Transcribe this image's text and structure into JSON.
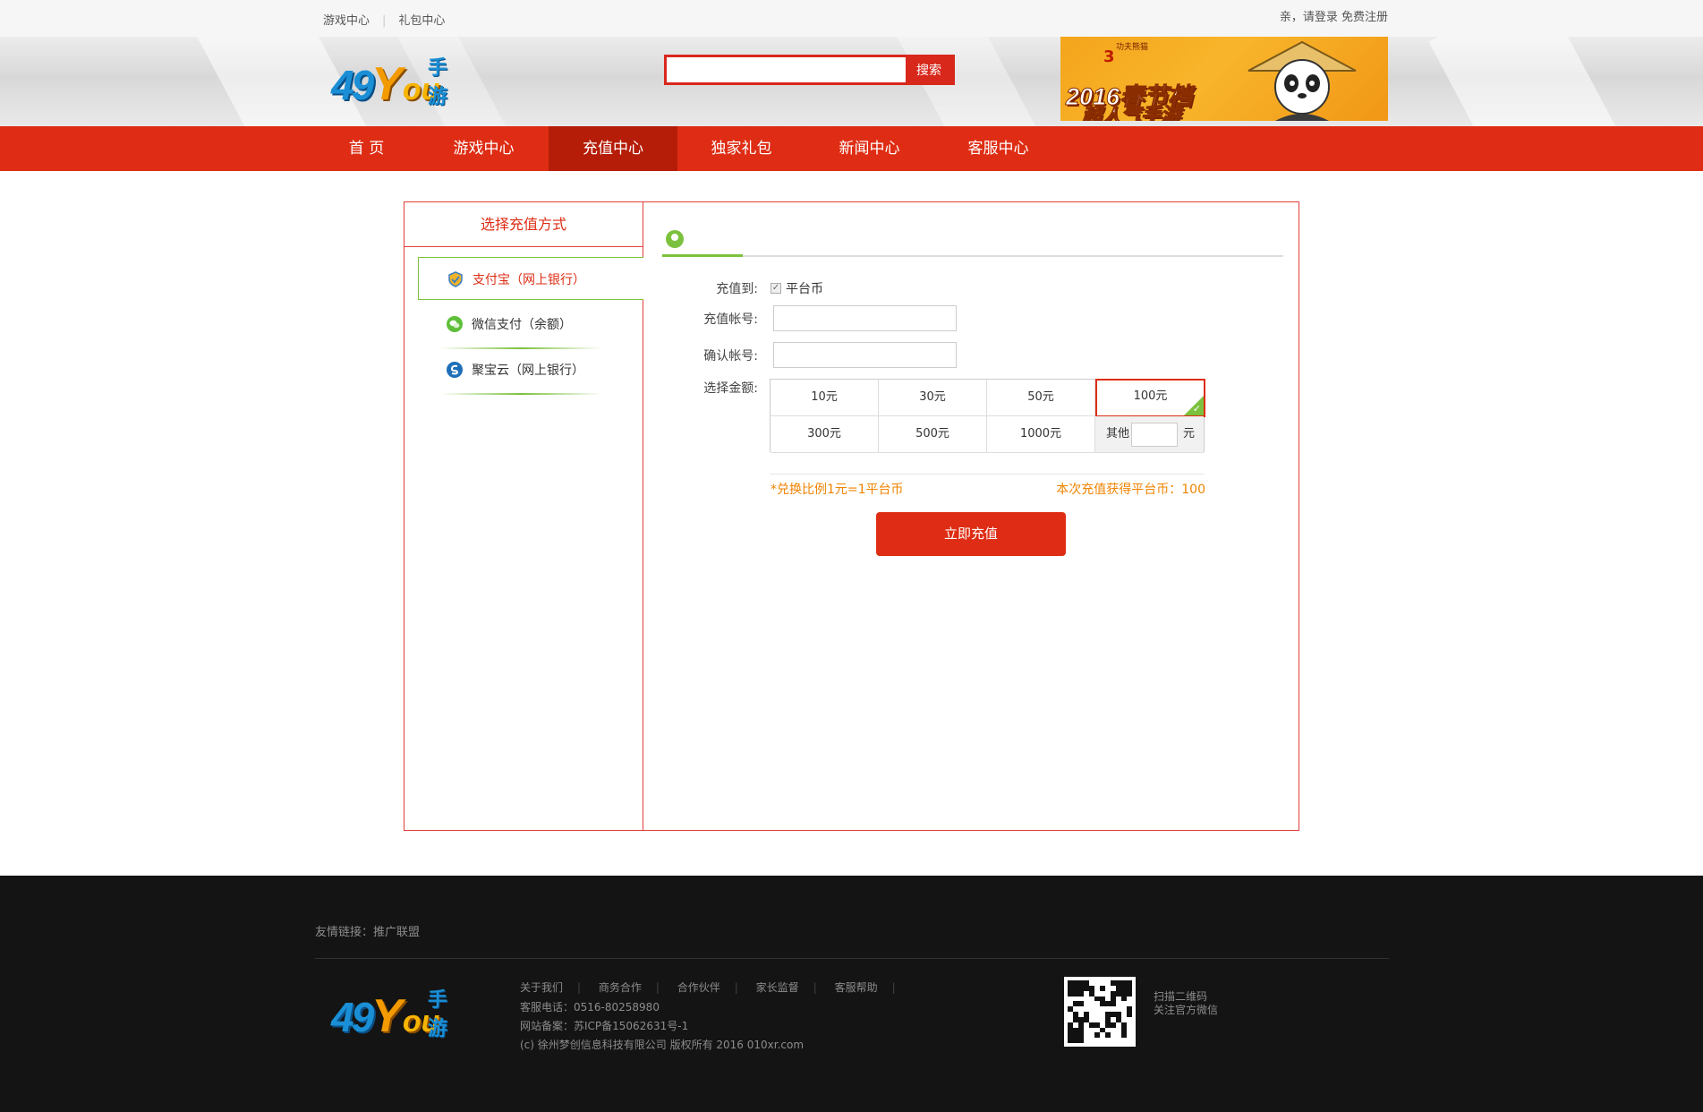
{
  "topbar": {
    "left_links": [
      "游戏中心",
      "礼包中心"
    ],
    "greeting": "亲，请登录",
    "register": "免费注册"
  },
  "logo": {
    "digits": "49",
    "y": "Y",
    "ou": "ou",
    "shouyou": "手游"
  },
  "search": {
    "placeholder": "",
    "button": "搜索"
  },
  "banner": {
    "line1": "2016春节档",
    "line2": "超人气手游",
    "small": "功夫熊猫",
    "num": "3"
  },
  "nav": {
    "items": [
      "首 页",
      "游戏中心",
      "充值中心",
      "独家礼包",
      "新闻中心",
      "客服中心"
    ],
    "active": "充值中心"
  },
  "sidebar": {
    "title": "选择充值方式",
    "methods": [
      {
        "label": "支付宝（网上银行）",
        "icon": "alipay-shield-icon",
        "active": true
      },
      {
        "label": "微信支付（余额）",
        "icon": "wechat-icon",
        "active": false
      },
      {
        "label": "聚宝云（网上银行）",
        "icon": "jubaoyun-icon",
        "active": false
      }
    ]
  },
  "form": {
    "recharge_to_label": "充值到:",
    "recharge_to_value": "平台币",
    "account_label": "充值帐号:",
    "account_value": "",
    "confirm_label": "确认帐号:",
    "confirm_value": "",
    "amount_label": "选择金额:",
    "amounts": [
      "10元",
      "30元",
      "50元",
      "100元",
      "300元",
      "500元",
      "1000元"
    ],
    "selected_amount": "100元",
    "other_label": "其他",
    "other_unit": "元",
    "ratio_text": "*兑换比例1元=1平台币",
    "earned_text": "本次充值获得平台币：100",
    "submit": "立即充值"
  },
  "footer": {
    "friends_label": "友情链接：",
    "friends_link": "推广联盟",
    "links": [
      "关于我们",
      "商务合作",
      "合作伙伴",
      "家长监督",
      "客服帮助"
    ],
    "phone": "客服电话：0516-80258980",
    "icp": "网站备案：苏ICP备15062631号-1",
    "copyright": "(c) 徐州梦创信息科技有限公司 版权所有 2016 010xr.com",
    "qr_line1": "扫描二维码",
    "qr_line2": "关注官方微信"
  },
  "colors": {
    "brand_red": "#de2d14",
    "active_nav": "#b51d08",
    "accent_green": "#7cc13d",
    "note_orange": "#f08300",
    "footer_bg": "#141414"
  }
}
